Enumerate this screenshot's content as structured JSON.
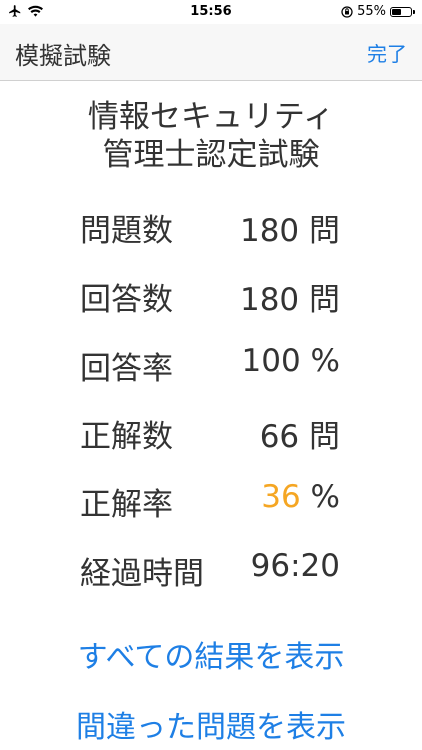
{
  "status": {
    "time": "15:56",
    "battery": "55%",
    "battery_level": 0.55
  },
  "nav": {
    "title": "模擬試験",
    "done": "完了"
  },
  "exam": {
    "title_line1": "情報セキュリティ",
    "title_line2": "管理士認定試験"
  },
  "stats": [
    {
      "label": "問題数",
      "value": "180",
      "unit": "問"
    },
    {
      "label": "回答数",
      "value": "180",
      "unit": "問"
    },
    {
      "label": "回答率",
      "value": "100",
      "unit": "%"
    },
    {
      "label": "正解数",
      "value": "66",
      "unit": "問"
    },
    {
      "label": "正解率",
      "value": "36",
      "unit": "%"
    },
    {
      "label": "経過時間",
      "value": "96:20",
      "unit": ""
    }
  ],
  "actions": {
    "show_all": "すべての結果を表示",
    "show_wrong": "間違った問題を表示"
  },
  "colors": {
    "accent": "#1e7fe5",
    "highlight": "#f5a623"
  }
}
